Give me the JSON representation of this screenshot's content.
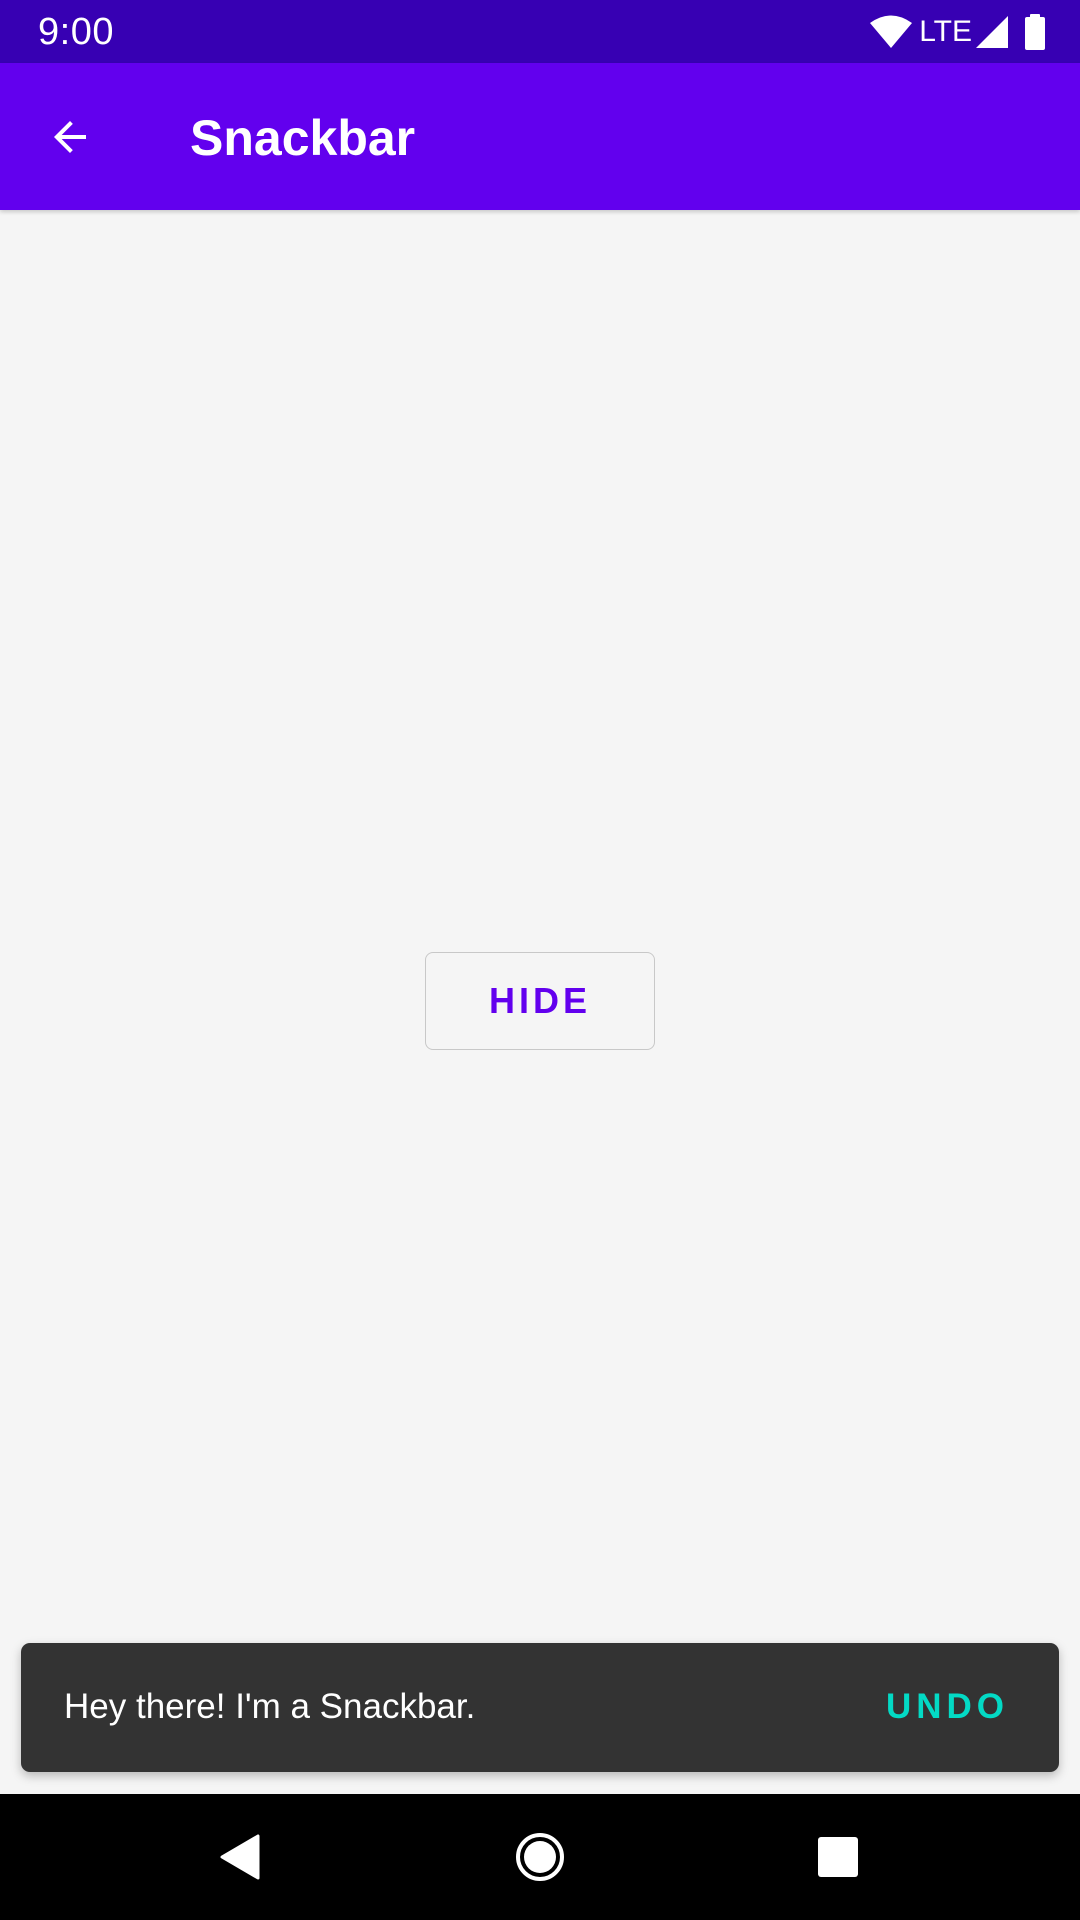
{
  "status_bar": {
    "time": "9:00",
    "network_label": "LTE",
    "icons": [
      "wifi-icon",
      "signal-icon",
      "battery-icon"
    ]
  },
  "app_bar": {
    "title": "Snackbar",
    "back_icon": "arrow-back-icon"
  },
  "main": {
    "hide_button_label": "HIDE"
  },
  "snackbar": {
    "message": "Hey there! I'm a Snackbar.",
    "action_label": "UNDO"
  },
  "nav_bar": {
    "icons": [
      "nav-back-icon",
      "nav-home-icon",
      "nav-recents-icon"
    ]
  },
  "colors": {
    "status_bar": "#3700b3",
    "app_bar": "#6200ee",
    "background": "#f5f5f5",
    "primary_text": "#6200ee",
    "snackbar_bg": "#333333",
    "snackbar_action": "#03dac5",
    "nav_bar": "#000000"
  }
}
